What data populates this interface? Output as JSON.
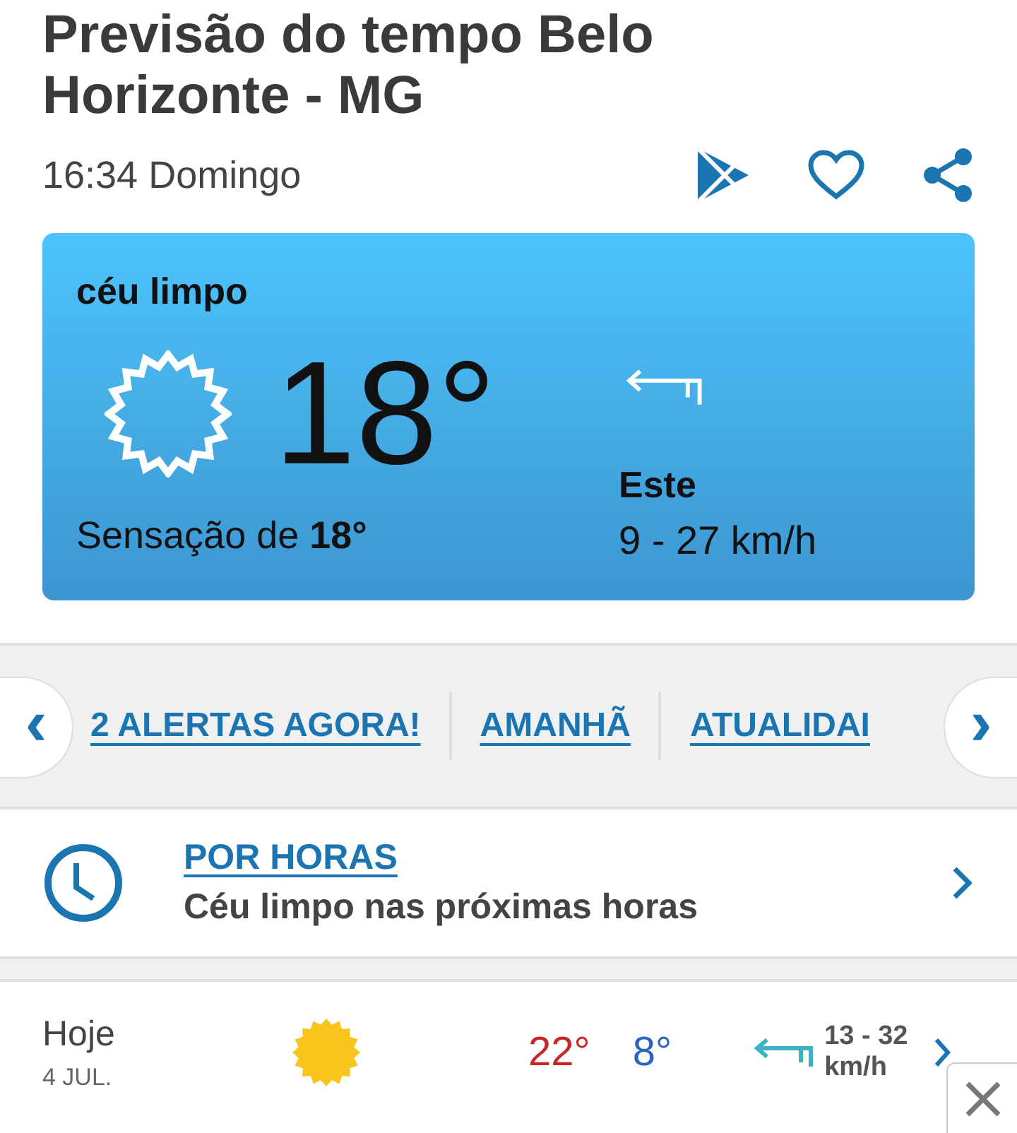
{
  "header": {
    "title": "Previsão do tempo Belo Horizonte - MG",
    "datetime": "16:34 Domingo"
  },
  "current": {
    "condition": "céu limpo",
    "temperature": "18°",
    "feels_like": "Sensação de **18°**",
    "wind_direction": "Este",
    "wind_speed": "9 - 27 km/h"
  },
  "nav": {
    "prev": "‹",
    "next": "›",
    "links": [
      {
        "label": "2 ALERTAS AGORA!"
      },
      {
        "label": "AMANHÃ"
      },
      {
        "label": "ATUALIDAI"
      }
    ]
  },
  "hourly": {
    "title": "POR HORAS",
    "summary": "Céu limpo nas próximas horas"
  },
  "days": [
    {
      "day": "Hoje",
      "date": "4 JUL.",
      "max": "22°",
      "min": "8°",
      "wind": "13 - 32",
      "wind_unit": "km/h"
    }
  ]
}
